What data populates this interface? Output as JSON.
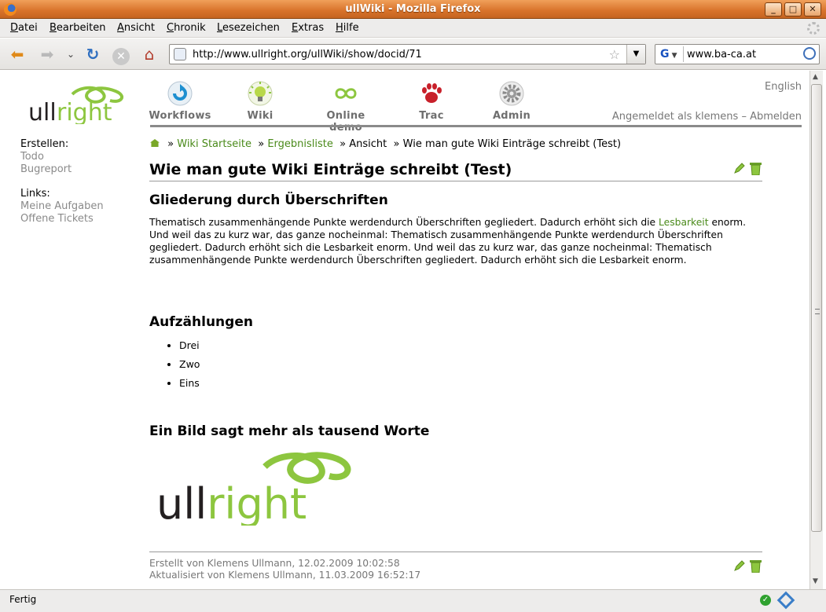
{
  "window": {
    "title": "ullWiki - Mozilla Firefox",
    "minimize": "_",
    "maximize": "□",
    "close": "✕"
  },
  "menu": {
    "items": [
      "Datei",
      "Bearbeiten",
      "Ansicht",
      "Chronik",
      "Lesezeichen",
      "Extras",
      "Hilfe"
    ]
  },
  "nav": {
    "url": "http://www.ullright.org/ullWiki/show/docid/71",
    "search_value": "www.ba-ca.at",
    "search_engine": "G"
  },
  "header": {
    "logo_text": "ullright",
    "tabs": [
      "Workflows",
      "Wiki",
      "Online demo",
      "Trac",
      "Admin"
    ],
    "language": "English",
    "login_prefix": "Angemeldet als klemens",
    "separator": "–",
    "logout": "Abmelden"
  },
  "sidebar": {
    "create_label": "Erstellen:",
    "create_items": [
      "Todo",
      "Bugreport"
    ],
    "links_label": "Links:",
    "link_items": [
      "Meine Aufgaben",
      "Offene Tickets"
    ]
  },
  "breadcrumb": {
    "sep": "»",
    "items": [
      "Wiki Startseite",
      "Ergebnisliste",
      "Ansicht",
      "Wie man gute Wiki Einträge schreibt (Test)"
    ]
  },
  "article": {
    "title": "Wie man gute Wiki Einträge schreibt (Test)",
    "section1": "Gliederung durch Überschriften",
    "para_a": "Thematisch zusammenhängende Punkte werdendurch Überschriften gegliedert. Dadurch erhöht sich die ",
    "para_link": "Lesbarkeit",
    "para_b": " enorm. Und weil das zu kurz war, das ganze nocheinmal: Thematisch zusammenhängende Punkte werdendurch Überschriften gegliedert. Dadurch erhöht sich die Lesbarkeit enorm. Und weil das zu kurz war, das ganze nocheinmal: Thematisch zusammenhängende Punkte werdendurch Überschriften gegliedert. Dadurch erhöht sich die Lesbarkeit enorm.",
    "section2": "Aufzählungen",
    "list": [
      "Drei",
      "Zwo",
      "Eins"
    ],
    "section3": "Ein Bild sagt mehr als tausend Worte",
    "image_logo_text": "ullright",
    "created": "Erstellt von Klemens Ullmann, 12.02.2009 10:02:58",
    "updated": "Aktualisiert von Klemens Ullmann, 11.03.2009 16:52:17"
  },
  "status": {
    "text": "Fertig"
  },
  "colors": {
    "brand_green": "#8dc63f",
    "link_green": "#4a8a1a",
    "titlebar_orange": "#d8722a"
  }
}
